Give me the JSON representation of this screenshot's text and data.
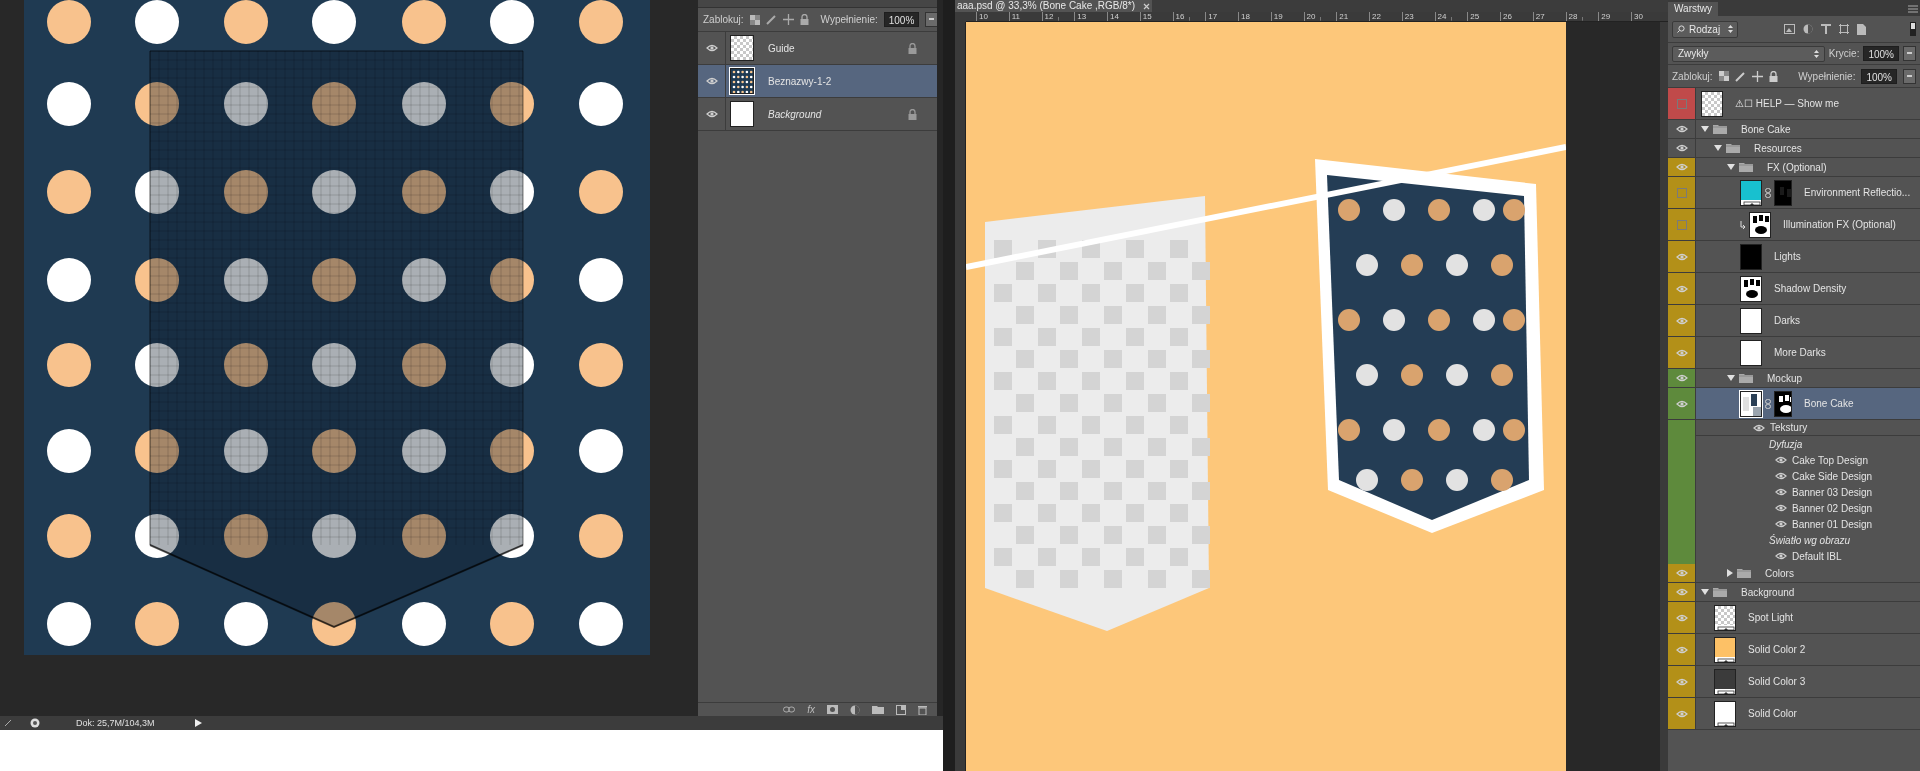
{
  "left_window": {
    "layers_panel": {
      "lock_label": "Zablokuj:",
      "fill_label": "Wypełnienie:",
      "fill_value": "100%",
      "layers": [
        {
          "name": "Guide",
          "kind": "layer",
          "thumbnail": {
            "kind": "transparent"
          },
          "visible": true,
          "selected": false,
          "locked": true
        },
        {
          "name": "Beznazwy-1-2",
          "kind": "smart-object",
          "thumbnail": {
            "kind": "pattern"
          },
          "visible": true,
          "selected": true,
          "locked": false
        },
        {
          "name": "Background",
          "kind": "background",
          "thumbnail": {
            "kind": "white"
          },
          "visible": true,
          "selected": false,
          "locked": true
        }
      ],
      "fx_button": "fx"
    },
    "status_bar": {
      "doc_size": "Dok: 25,7M/104,3M"
    }
  },
  "right_window": {
    "tab_title": "aaa.psd @ 33,3% (Bone Cake ,RGB/8*)",
    "ruler": [
      "10",
      "11",
      "12",
      "13",
      "14",
      "15",
      "16",
      "17",
      "18",
      "19",
      "20",
      "21",
      "22",
      "23",
      "24",
      "25",
      "26",
      "27",
      "28",
      "29",
      "30"
    ]
  },
  "layers_panel": {
    "tab": "Warstwy",
    "filter": "Rodzaj",
    "blend_mode": "Zwykły",
    "opacity_label": "Krycie:",
    "opacity": "100%",
    "lock_label": "Zablokuj:",
    "fill_label": "Wypełnienie:",
    "fill": "100%",
    "layers": [
      {
        "kind": "layer",
        "name": "⚠☐ HELP — Show me",
        "thumbnail": {
          "kind": "transparent"
        },
        "visible": false,
        "selected": false,
        "color": "#c04a4a"
      },
      {
        "kind": "group",
        "name": "Bone Cake",
        "visible": true,
        "selected": false,
        "expanded": true,
        "children": [
          {
            "kind": "group",
            "name": "Resources",
            "visible": true,
            "selected": false,
            "expanded": true,
            "children": [
              {
                "kind": "group",
                "name": "FX (Optional)",
                "visible": true,
                "selected": false,
                "expanded": true,
                "color": "#b39018",
                "children": [
                  {
                    "kind": "layer",
                    "name": "Environment Reflectio...",
                    "thumbnail": {
                      "kind": "cyan-fill"
                    },
                    "mask": {
                      "kind": "dark"
                    },
                    "clipped": false,
                    "visible": false,
                    "selected": false,
                    "color": "#b39018"
                  },
                  {
                    "kind": "layer",
                    "name": "Illumination FX (Optional)",
                    "thumbnail": {
                      "kind": "blobs"
                    },
                    "clipped": true,
                    "visible": false,
                    "selected": false,
                    "color": "#b39018"
                  },
                  {
                    "kind": "layer",
                    "name": "Lights",
                    "thumbnail": {
                      "kind": "black"
                    },
                    "visible": true,
                    "selected": false,
                    "color": "#b39018"
                  },
                  {
                    "kind": "layer",
                    "name": "Shadow Density",
                    "thumbnail": {
                      "kind": "blobs"
                    },
                    "visible": true,
                    "selected": false,
                    "color": "#b39018"
                  },
                  {
                    "kind": "layer",
                    "name": "Darks",
                    "thumbnail": {
                      "kind": "white"
                    },
                    "visible": true,
                    "selected": false,
                    "color": "#b39018"
                  },
                  {
                    "kind": "layer",
                    "name": "More Darks",
                    "thumbnail": {
                      "kind": "white"
                    },
                    "visible": true,
                    "selected": false,
                    "color": "#b39018"
                  }
                ]
              },
              {
                "kind": "group",
                "name": "Mockup",
                "visible": true,
                "selected": false,
                "expanded": true,
                "color": "#5e8a3c",
                "children": [
                  {
                    "kind": "layer",
                    "name": "Bone Cake",
                    "thumbnail": {
                      "kind": "smart-mockup"
                    },
                    "mask": {
                      "kind": "blobs"
                    },
                    "visible": true,
                    "selected": true,
                    "color": "#5e8a3c",
                    "children": [
                      {
                        "kind": "effect",
                        "name": "Tekstury",
                        "children": [
                          {
                            "kind": "heading",
                            "name": "Dyfuzja",
                            "children": [
                              {
                                "kind": "effect",
                                "name": "Cake Top Design"
                              },
                              {
                                "kind": "effect",
                                "name": "Cake Side Design"
                              },
                              {
                                "kind": "effect",
                                "name": "Banner 03 Design"
                              },
                              {
                                "kind": "effect",
                                "name": "Banner 02 Design"
                              },
                              {
                                "kind": "effect",
                                "name": "Banner 01 Design"
                              }
                            ]
                          },
                          {
                            "kind": "heading",
                            "name": "Światło wg obrazu",
                            "children": [
                              {
                                "kind": "effect",
                                "name": "Default IBL"
                              }
                            ]
                          }
                        ]
                      }
                    ]
                  }
                ]
              },
              {
                "kind": "group",
                "name": "Colors",
                "visible": true,
                "selected": false,
                "expanded": false,
                "color": "#b39018"
              }
            ]
          }
        ]
      },
      {
        "kind": "group",
        "name": "Background",
        "visible": true,
        "selected": false,
        "expanded": true,
        "color": "#b39018",
        "children": [
          {
            "kind": "layer",
            "name": "Spot Light",
            "thumbnail": {
              "kind": "transparent-fill"
            },
            "visible": true,
            "selected": false,
            "color": "#b39018"
          },
          {
            "kind": "layer",
            "name": "Solid Color 2",
            "thumbnail": {
              "kind": "orange-fill"
            },
            "visible": true,
            "selected": false,
            "color": "#b39018"
          },
          {
            "kind": "layer",
            "name": "Solid Color 3",
            "thumbnail": {
              "kind": "dark-fill"
            },
            "visible": true,
            "selected": false,
            "color": "#b39018"
          },
          {
            "kind": "layer",
            "name": "Solid Color",
            "thumbnail": {
              "kind": "white-fill"
            },
            "visible": true,
            "selected": false,
            "color": "#b39018"
          }
        ]
      }
    ]
  }
}
